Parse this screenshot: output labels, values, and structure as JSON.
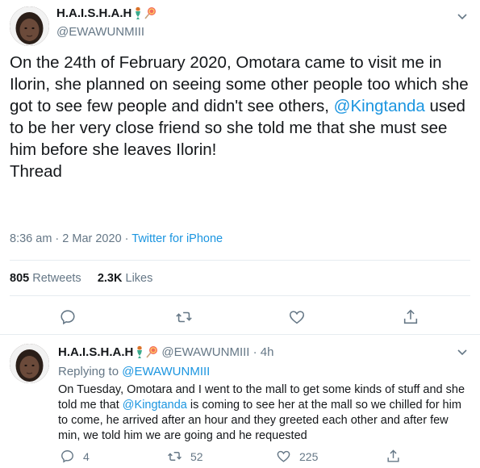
{
  "main_tweet": {
    "display_name": "H.A.I.S.H.A.H",
    "handle": "@EWAWUNMIII",
    "text_part1": "On the 24th of February 2020, Omotara came to visit me in Ilorin, she planned on seeing some other people too which she got to see few people and didn't see others, ",
    "mention": "@Kingtanda",
    "text_part2": " used to be her very close friend so she told me that she must see him before she leaves Ilorin!\nThread",
    "time": "8:36 am · 2 Mar 2020 · ",
    "source": "Twitter for iPhone",
    "retweets_count": "805",
    "retweets_label": "Retweets",
    "likes_count": "2.3K",
    "likes_label": "Likes",
    "icons": {
      "reply": "reply-icon",
      "retweet": "retweet-icon",
      "like": "heart-icon",
      "share": "share-icon"
    }
  },
  "reply_tweet": {
    "display_name": "H.A.I.S.H.A.H",
    "handle_time": "@EWAWUNMIII · 4h",
    "replying_to_label": "Replying to ",
    "replying_to_handle": "@EWAWUNMIII",
    "text_part1": "On Tuesday, Omotara and I went to the mall to get some kinds of stuff and she told me that ",
    "mention": "@Kingtanda",
    "text_part2": " is coming to see her at the mall so we chilled for him to come, he arrived after an hour and they greeted each other and after few min, we told him we are going and he requested",
    "replies": "4",
    "retweets": "52",
    "likes": "225"
  },
  "colors": {
    "link": "#1b95e0",
    "muted": "#657786",
    "text": "#14171a",
    "divider": "#e6ecf0"
  }
}
